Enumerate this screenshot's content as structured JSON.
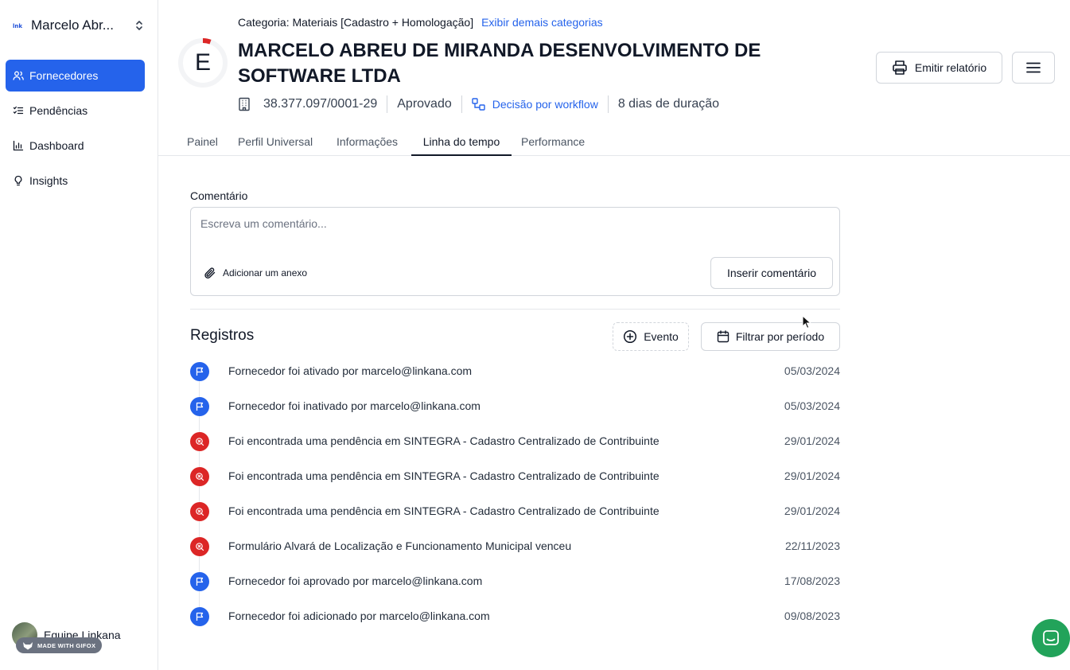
{
  "sidebar": {
    "workspace": {
      "name": "Marcelo Abr...",
      "logo": "linkana"
    },
    "items": [
      {
        "label": "Fornecedores",
        "icon": "users-icon",
        "active": true
      },
      {
        "label": "Pendências",
        "icon": "list-check-icon",
        "active": false
      },
      {
        "label": "Dashboard",
        "icon": "bar-chart-icon",
        "active": false
      },
      {
        "label": "Insights",
        "icon": "lightbulb-icon",
        "active": false
      }
    ],
    "footer": {
      "team": "Equipe Linkana"
    },
    "watermark": "MADE WITH GIFOX"
  },
  "header": {
    "category_prefix": "Categoria: Materiais [Cadastro + Homologação]",
    "category_link": "Exibir demais categorias",
    "score_letter": "E",
    "company_name": "MARCELO ABREU DE MIRANDA DESENVOLVIMENTO DE SOFTWARE LTDA",
    "cnpj": "38.377.097/0001-29",
    "status": "Aprovado",
    "decision": "Decisão por workflow",
    "duration": "8 dias de duração",
    "report_button": "Emitir relatório"
  },
  "tabs": [
    {
      "label": "Painel",
      "active": false
    },
    {
      "label": "Perfil Universal",
      "active": false
    },
    {
      "label": "Informações",
      "active": false
    },
    {
      "label": "Linha do tempo",
      "active": true
    },
    {
      "label": "Performance",
      "active": false
    }
  ],
  "comment": {
    "label": "Comentário",
    "placeholder": "Escreva um comentário...",
    "value": "",
    "attach_label": "Adicionar um anexo",
    "submit_label": "Inserir comentário"
  },
  "records": {
    "title": "Registros",
    "event_button": "Evento",
    "filter_button": "Filtrar por período",
    "items": [
      {
        "text": "Fornecedor foi ativado por marcelo@linkana.com",
        "date": "05/03/2024",
        "type": "flag",
        "color": "#2563eb"
      },
      {
        "text": "Fornecedor foi inativado por marcelo@linkana.com",
        "date": "05/03/2024",
        "type": "flag",
        "color": "#2563eb"
      },
      {
        "text": "Foi encontrada uma pendência em SINTEGRA - Cadastro Centralizado de Contribuinte",
        "date": "29/01/2024",
        "type": "alert",
        "color": "#dc2626"
      },
      {
        "text": "Foi encontrada uma pendência em SINTEGRA - Cadastro Centralizado de Contribuinte",
        "date": "29/01/2024",
        "type": "alert",
        "color": "#dc2626"
      },
      {
        "text": "Foi encontrada uma pendência em SINTEGRA - Cadastro Centralizado de Contribuinte",
        "date": "29/01/2024",
        "type": "alert",
        "color": "#dc2626"
      },
      {
        "text": "Formulário Alvará de Localização e Funcionamento Municipal venceu",
        "date": "22/11/2023",
        "type": "alert",
        "color": "#dc2626"
      },
      {
        "text": "Fornecedor foi aprovado por marcelo@linkana.com",
        "date": "17/08/2023",
        "type": "flag",
        "color": "#2563eb"
      },
      {
        "text": "Fornecedor foi adicionado por marcelo@linkana.com",
        "date": "09/08/2023",
        "type": "flag",
        "color": "#2563eb"
      }
    ]
  },
  "colors": {
    "accent": "#2563eb",
    "danger": "#dc2626",
    "chat": "#22a35a"
  }
}
